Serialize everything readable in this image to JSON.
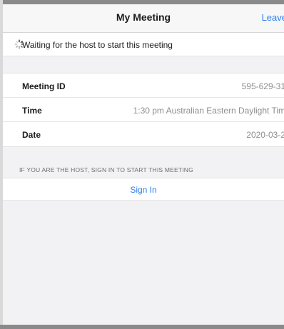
{
  "nav": {
    "title": "My Meeting",
    "leave_label": "Leave"
  },
  "status": {
    "text": "Waiting for the host to start this meeting",
    "icon": "spinner-icon"
  },
  "meeting_info": {
    "rows": [
      {
        "label": "Meeting ID",
        "value": "595-629-31"
      },
      {
        "label": "Time",
        "value": "1:30 pm Australian Eastern Daylight Tim"
      },
      {
        "label": "Date",
        "value": "2020-03-2"
      }
    ]
  },
  "host_section": {
    "header": "IF YOU ARE THE HOST, SIGN IN TO START THIS MEETING",
    "sign_in_label": "Sign In"
  },
  "colors": {
    "accent": "#2a7ff3",
    "background": "#f2f2f4",
    "secondary_text": "#8e8e93"
  }
}
